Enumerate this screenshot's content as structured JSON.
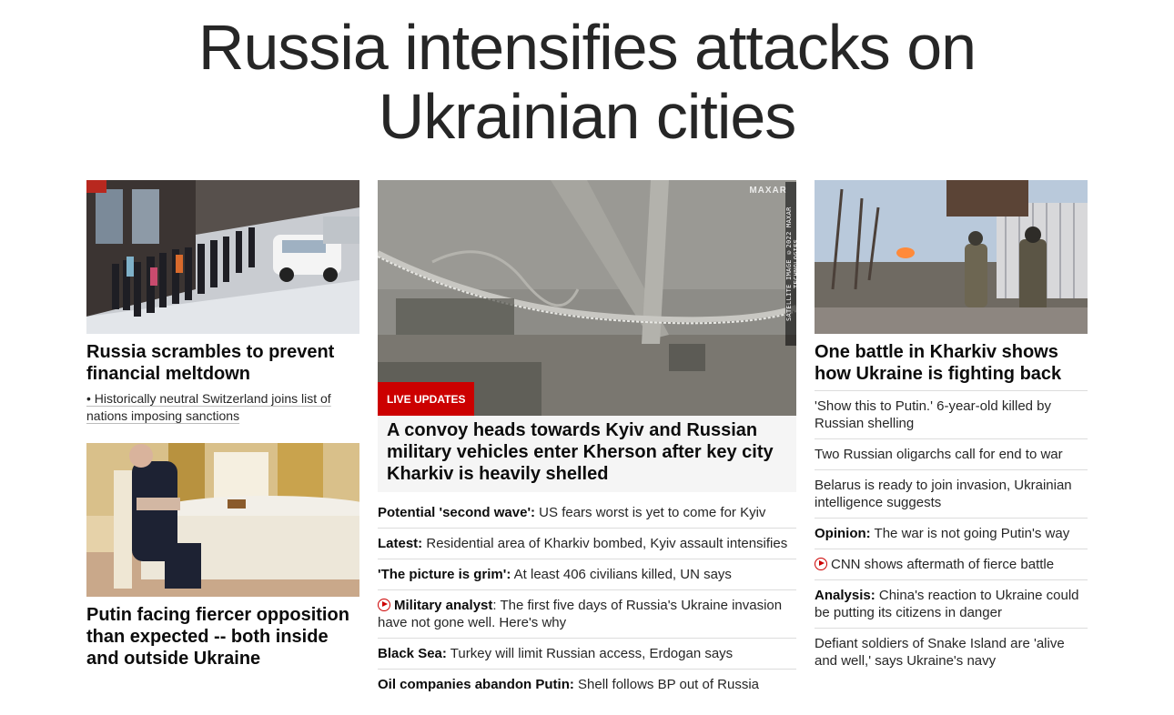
{
  "headline": "Russia intensifies attacks on Ukrainian cities",
  "left": {
    "story1": {
      "title": "Russia scrambles to prevent financial meltdown",
      "sub": "• Historically neutral Switzerland joins list of nations imposing sanctions"
    },
    "story2": {
      "title": "Putin facing fiercer opposition than expected -- both inside and outside Ukraine"
    }
  },
  "center": {
    "badge": "LIVE UPDATES",
    "image_credit": "SATELLITE IMAGE ©2022 MAXAR TECHNOLOGIES",
    "watermark": "MAXAR",
    "title": "A convoy heads towards Kyiv and Russian military vehicles enter Kherson after key city Kharkiv is heavily shelled",
    "items": [
      {
        "bold": "Potential 'second wave':",
        "text": " US fears worst is yet to come for Kyiv"
      },
      {
        "bold": "Latest:",
        "text": " Residential area of Kharkiv bombed, Kyiv assault intensifies"
      },
      {
        "bold": "'The picture is grim':",
        "text": " At least 406 civilians killed, UN says"
      },
      {
        "bold": "Military analyst",
        "text": ": The first five days of Russia's Ukraine invasion have not gone well. Here's why",
        "video": true
      },
      {
        "bold": "Black Sea:",
        "text": " Turkey will limit Russian access, Erdogan says"
      },
      {
        "bold": "Oil companies abandon Putin:",
        "text": " Shell follows BP out of Russia"
      }
    ]
  },
  "right": {
    "title": "One battle in Kharkiv shows how Ukraine is fighting back",
    "items": [
      {
        "bold": "",
        "text": "'Show this to Putin.' 6-year-old killed by Russian shelling"
      },
      {
        "bold": "",
        "text": "Two Russian oligarchs call for end to war"
      },
      {
        "bold": "",
        "text": "Belarus is ready to join invasion, Ukrainian intelligence suggests"
      },
      {
        "bold": "Opinion:",
        "text": " The war is not going Putin's way"
      },
      {
        "bold": "",
        "text": "CNN shows aftermath of fierce battle",
        "video": true
      },
      {
        "bold": "Analysis:",
        "text": " China's reaction to Ukraine could be putting its citizens in danger"
      },
      {
        "bold": "",
        "text": "Defiant soldiers of Snake Island are 'alive and well,' says Ukraine's navy"
      }
    ]
  },
  "colors": {
    "accent_red": "#cc0000",
    "text": "#0c0c0c",
    "muted": "#262626",
    "divider": "#dcdcdc"
  }
}
